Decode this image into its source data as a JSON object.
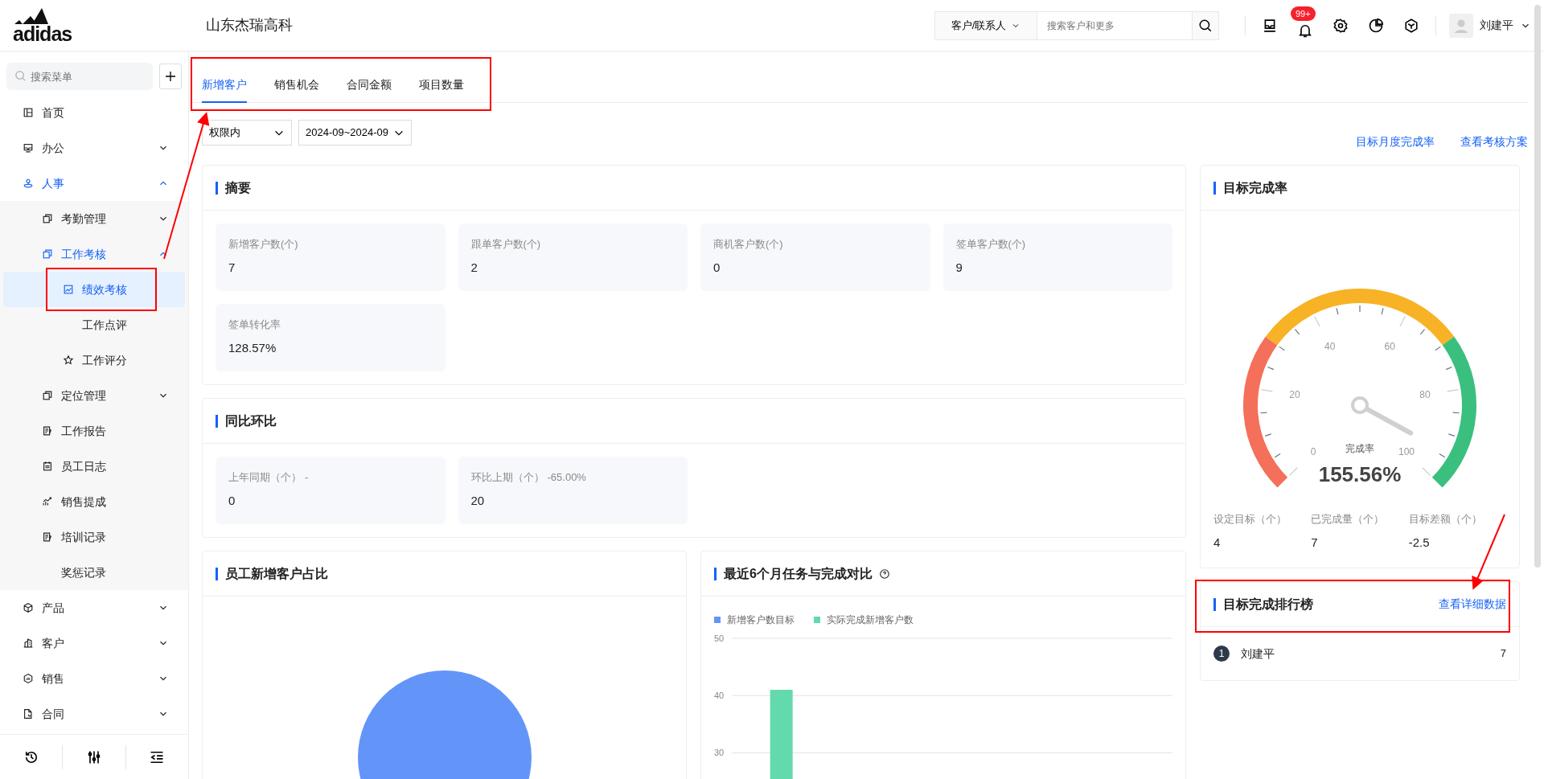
{
  "header": {
    "logo": "adidas",
    "company": "山东杰瑞高科",
    "search": {
      "scope": "客户/联系人",
      "placeholder": "搜索客户和更多"
    },
    "notification_badge": "99+",
    "user": "刘建平"
  },
  "sidebar": {
    "search_placeholder": "搜索菜单",
    "items": [
      {
        "label": "首页",
        "selected": false
      },
      {
        "label": "办公",
        "expanded": false,
        "selected": false
      },
      {
        "label": "人事",
        "expanded": true,
        "selected": false,
        "children": [
          {
            "label": "考勤管理",
            "expanded": false,
            "selected": false
          },
          {
            "label": "工作考核",
            "expanded": true,
            "selected": false,
            "children": [
              {
                "label": "绩效考核",
                "selected": true
              },
              {
                "label": "工作点评",
                "selected": false
              },
              {
                "label": "工作评分",
                "selected": false
              }
            ]
          },
          {
            "label": "定位管理",
            "expanded": false,
            "selected": false
          },
          {
            "label": "工作报告",
            "selected": false
          },
          {
            "label": "员工日志",
            "selected": false
          },
          {
            "label": "销售提成",
            "selected": false
          },
          {
            "label": "培训记录",
            "selected": false
          },
          {
            "label": "奖惩记录",
            "selected": false
          }
        ]
      },
      {
        "label": "产品",
        "expanded": false,
        "selected": false
      },
      {
        "label": "客户",
        "expanded": false,
        "selected": false
      },
      {
        "label": "销售",
        "expanded": false,
        "selected": false
      },
      {
        "label": "合同",
        "expanded": false,
        "selected": false
      }
    ]
  },
  "tabs": [
    {
      "label": "新增客户",
      "selected": true
    },
    {
      "label": "销售机会",
      "selected": false
    },
    {
      "label": "合同金额",
      "selected": false
    },
    {
      "label": "项目数量",
      "selected": false
    }
  ],
  "filters": [
    {
      "value": "权限内"
    },
    {
      "value": "2024-09~2024-09"
    }
  ],
  "links": [
    "目标月度完成率",
    "查看考核方案"
  ],
  "summary": {
    "title": "摘要",
    "stats": [
      {
        "label": "新增客户数(个)",
        "value": "7"
      },
      {
        "label": "跟单客户数(个)",
        "value": "2"
      },
      {
        "label": "商机客户数(个)",
        "value": "0"
      },
      {
        "label": "签单客户数(个)",
        "value": "9"
      },
      {
        "label": "签单转化率",
        "value": "128.57%"
      }
    ]
  },
  "comparison": {
    "title": "同比环比",
    "stats": [
      {
        "label": "上年同期（个）",
        "change": "-",
        "value": "0"
      },
      {
        "label": "环比上期（个）",
        "change": "-65.00%",
        "value": "20"
      }
    ]
  },
  "share_chart": {
    "title": "员工新增客户占比"
  },
  "trend_chart": {
    "title": "最近6个月任务与完成对比",
    "chart_data": {
      "type": "bar",
      "ylim": [
        25,
        50
      ],
      "yticks": [
        {
          "value": 30,
          "label": "30"
        },
        {
          "value": 40,
          "label": "40"
        },
        {
          "value": 50,
          "label": "50"
        }
      ],
      "series": [
        {
          "name": "新增客户数目标",
          "color": "#6395f9",
          "values": [
            null,
            null,
            null,
            null,
            null,
            null
          ]
        },
        {
          "name": "实际完成新增客户数",
          "color": "#62daab",
          "values": [
            41,
            null,
            null,
            null,
            null,
            null
          ]
        }
      ]
    }
  },
  "target": {
    "title": "目标完成率",
    "gauge": {
      "tick_labels": [
        "0",
        "20",
        "40",
        "60",
        "80",
        "100"
      ],
      "caption": "完成率",
      "value": "155.56%"
    },
    "stats": [
      {
        "label": "设定目标（个）",
        "value": "4"
      },
      {
        "label": "已完成量（个）",
        "value": "7"
      },
      {
        "label": "目标差额（个）",
        "value": "-2.5"
      }
    ]
  },
  "ranking": {
    "title": "目标完成排行榜",
    "link": "查看详细数据",
    "rows": [
      {
        "rank": "1",
        "name": "刘建平",
        "value": "7"
      }
    ]
  },
  "annotations": [
    {
      "kind": "box"
    },
    {
      "kind": "box"
    },
    {
      "kind": "box"
    },
    {
      "kind": "arrow"
    },
    {
      "kind": "arrow"
    }
  ]
}
